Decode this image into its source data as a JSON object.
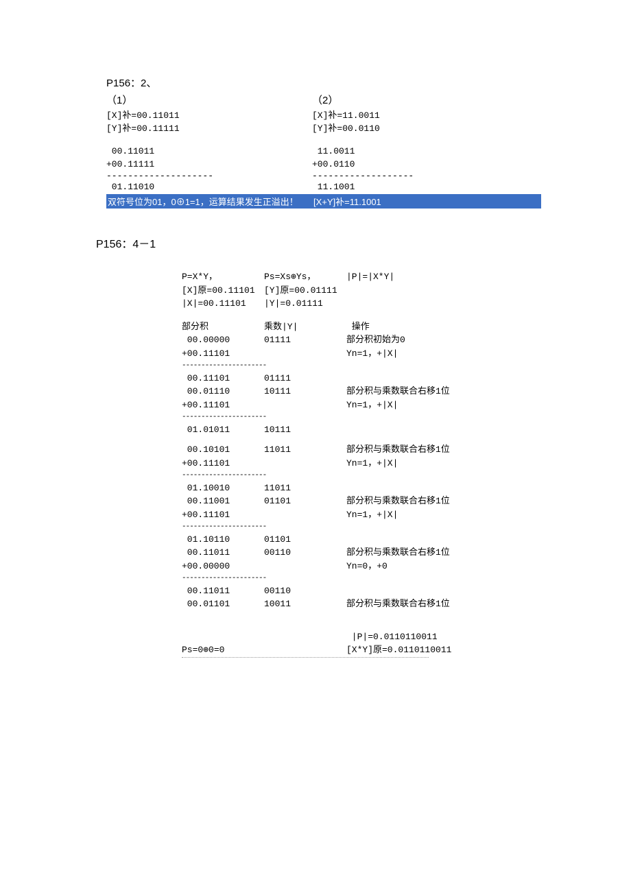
{
  "s1": {
    "title": "P156：2、",
    "p1": {
      "label": "（1）",
      "x": "[X]补=00.11011",
      "y": "[Y]补=00.11111",
      "a": " 00.11011",
      "b": "+00.11111",
      "sep": "--------------------",
      "r": " 01.11010",
      "note": "双符号位为01，0⊕1=1，运算结果发生正溢出！"
    },
    "p2": {
      "label": "（2）",
      "x": "[X]补=11.0011",
      "y": "[Y]补=00.0110",
      "a": " 11.0011",
      "b": "+00.0110",
      "sep": "-------------------",
      "r": " 11.1001",
      "note": "[X+Y]补=11.1001"
    }
  },
  "s2": {
    "title": "P156：4－1",
    "hdr": {
      "c1a": "P=X*Y，",
      "c2a": "Ps=Xs⊕Ys，",
      "c3a": "|P|=|X*Y|",
      "c1b": "[X]原=00.11101",
      "c2b": "[Y]原=00.01111",
      "c1c": "|X|=00.11101",
      "c2c": "|Y|=0.01111"
    },
    "th": {
      "c1": "部分积",
      "c2": "乘数|Y|",
      "c3": " 操作"
    },
    "rows": [
      {
        "c1": " 00.00000",
        "c2": "01111",
        "c3": "部分积初始为0"
      },
      {
        "c1": "+00.11101",
        "c2": "",
        "c3": "Yn=1，+|X|"
      },
      {
        "sep": true
      },
      {
        "c1": " 00.11101",
        "c2": "01111",
        "c3": ""
      },
      {
        "c1": " 00.01110",
        "c2": "10111",
        "c3": "部分积与乘数联合右移1位"
      },
      {
        "c1": "+00.11101",
        "c2": "",
        "c3": "Yn=1，+|X|"
      },
      {
        "sep": true
      },
      {
        "c1": " 01.01011",
        "c2": "10111",
        "c3": ""
      },
      {
        "sp": true
      },
      {
        "c1": " 00.10101",
        "c2": "11011",
        "c3": "部分积与乘数联合右移1位"
      },
      {
        "c1": "+00.11101",
        "c2": "",
        "c3": "Yn=1，+|X|"
      },
      {
        "sep": true
      },
      {
        "c1": " 01.10010",
        "c2": "11011",
        "c3": ""
      },
      {
        "c1": " 00.11001",
        "c2": "01101",
        "c3": "部分积与乘数联合右移1位"
      },
      {
        "c1": "+00.11101",
        "c2": "",
        "c3": "Yn=1，+|X|"
      },
      {
        "sep": true
      },
      {
        "c1": " 01.10110",
        "c2": "01101",
        "c3": ""
      },
      {
        "c1": " 00.11011",
        "c2": "00110",
        "c3": "部分积与乘数联合右移1位"
      },
      {
        "c1": "+00.00000",
        "c2": "",
        "c3": "Yn=0，+0"
      },
      {
        "sep": true
      },
      {
        "c1": " 00.11011",
        "c2": "00110",
        "c3": ""
      },
      {
        "c1": " 00.01101",
        "c2": "10011",
        "c3": "部分积与乘数联合右移1位"
      }
    ],
    "final": {
      "ps": "Ps=0⊕0=0",
      "p1": " |P|=0.0110110011",
      "p2": "[X*Y]原=0.0110110011"
    }
  }
}
